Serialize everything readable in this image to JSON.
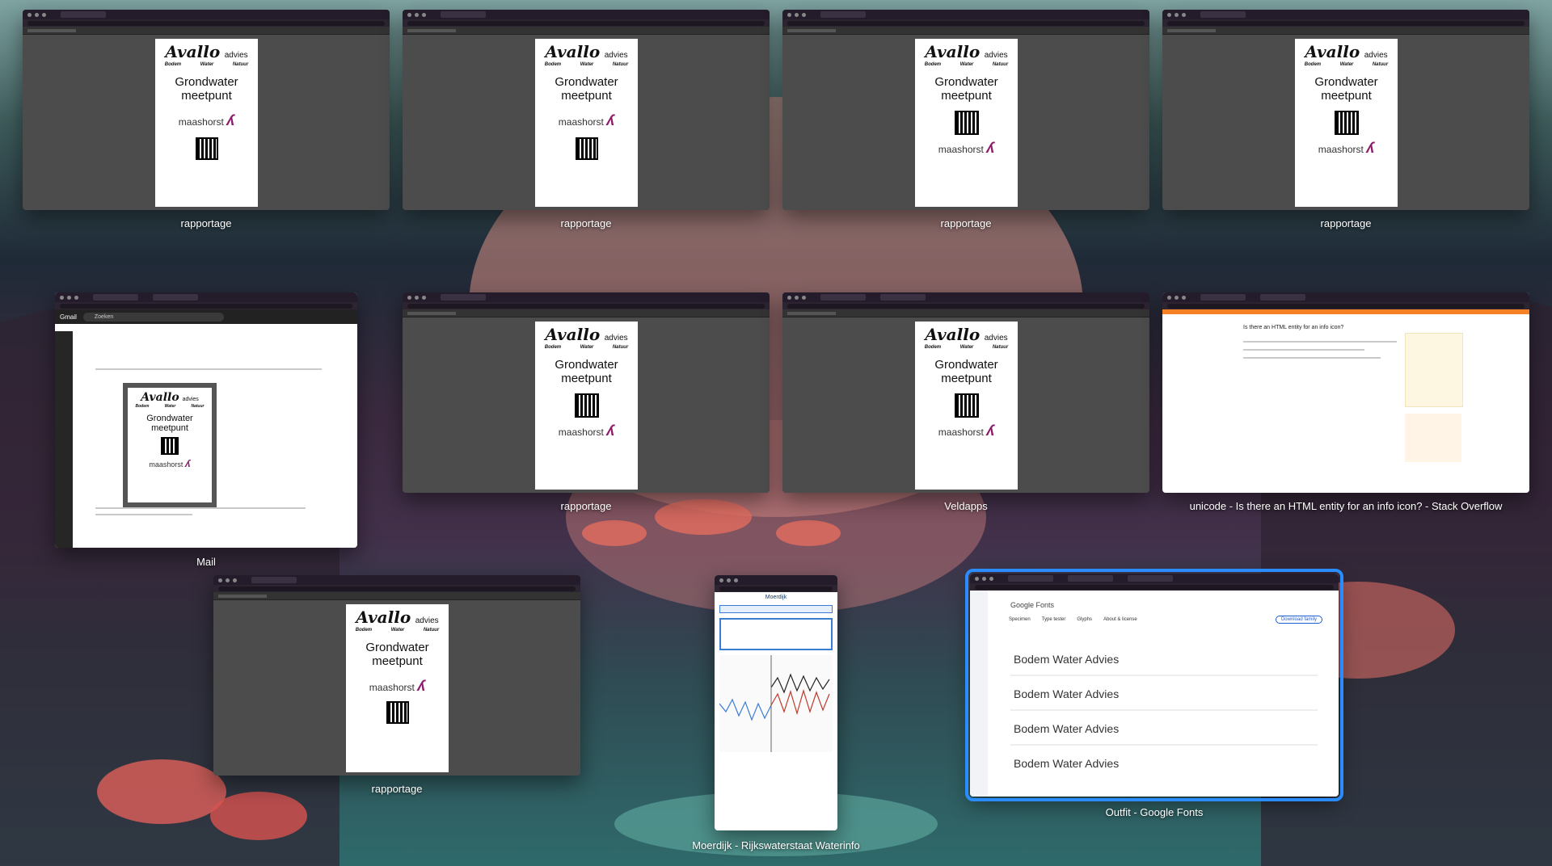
{
  "windows": [
    {
      "id": "w1",
      "label": "rapportage"
    },
    {
      "id": "w2",
      "label": "rapportage"
    },
    {
      "id": "w3",
      "label": "rapportage"
    },
    {
      "id": "w4",
      "label": "rapportage"
    },
    {
      "id": "w5",
      "label": "Mail"
    },
    {
      "id": "w6",
      "label": "rapportage"
    },
    {
      "id": "w7",
      "label": "Veldapps"
    },
    {
      "id": "w8",
      "label": "unicode - Is there an HTML entity for an info icon? - Stack Overflow"
    },
    {
      "id": "w9",
      "label": "rapportage"
    },
    {
      "id": "w10",
      "label": "Moerdijk - Rijkswaterstaat Waterinfo"
    },
    {
      "id": "w11",
      "label": "Outfit - Google Fonts"
    }
  ],
  "poster": {
    "brand": "Avallo",
    "brand_suffix": "advies",
    "tags": [
      "Bodem",
      "Water",
      "Natuur"
    ],
    "title_line1": "Grondwater",
    "title_line2": "meetpunt",
    "maashorst": "maashorst"
  },
  "mail": {
    "app": "Gmail",
    "search_placeholder": "Zoeken"
  },
  "stackoverflow": {
    "question": "Is there an HTML entity for an info icon?"
  },
  "waterinfo": {
    "title": "Moerdijk"
  },
  "fonts": {
    "brand": "Google Fonts",
    "tabs": [
      "Specimen",
      "Type tester",
      "Glyphs",
      "About & license"
    ],
    "sample": "Bodem Water Advies",
    "button": "Download family"
  },
  "colors": {
    "accent": "#2a8cff",
    "brand_purple": "#8a1a6a"
  }
}
